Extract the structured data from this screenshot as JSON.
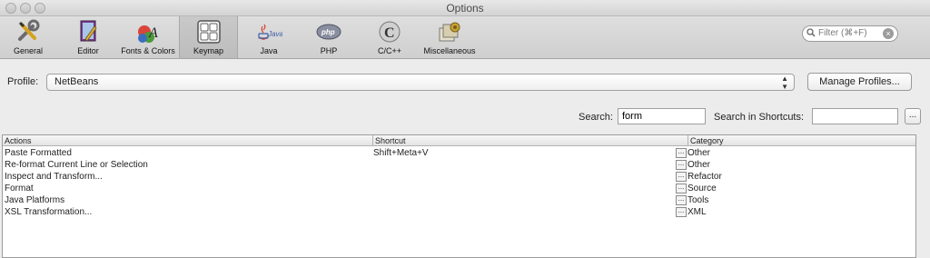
{
  "window": {
    "title": "Options"
  },
  "toolbar": {
    "tabs": [
      {
        "label": "General",
        "icon": "wrench-screwdriver-icon"
      },
      {
        "label": "Editor",
        "icon": "editor-pencil-icon"
      },
      {
        "label": "Fonts & Colors",
        "icon": "fonts-colors-icon"
      },
      {
        "label": "Keymap",
        "icon": "keyboard-icon",
        "selected": true
      },
      {
        "label": "Java",
        "icon": "java-icon"
      },
      {
        "label": "PHP",
        "icon": "php-icon"
      },
      {
        "label": "C/C++",
        "icon": "c-cpp-icon"
      },
      {
        "label": "Miscellaneous",
        "icon": "miscellaneous-icon"
      }
    ],
    "filter_placeholder": "Filter (⌘+F)"
  },
  "profile": {
    "label": "Profile:",
    "value": "NetBeans",
    "manage_button": "Manage Profiles..."
  },
  "search": {
    "label": "Search:",
    "value": "form",
    "shortcut_label": "Search in Shortcuts:",
    "shortcut_value": "",
    "more_button": "..."
  },
  "table": {
    "columns": [
      "Actions",
      "Shortcut",
      "Category"
    ],
    "rows": [
      {
        "action": "Paste Formatted",
        "shortcut": "Shift+Meta+V",
        "category": "Other"
      },
      {
        "action": "Re-format Current Line or Selection",
        "shortcut": "",
        "category": "Other"
      },
      {
        "action": "Inspect and Transform...",
        "shortcut": "",
        "category": "Refactor"
      },
      {
        "action": "Format",
        "shortcut": "",
        "category": "Source"
      },
      {
        "action": "Java Platforms",
        "shortcut": "",
        "category": "Tools"
      },
      {
        "action": "XSL Transformation...",
        "shortcut": "",
        "category": "XML"
      }
    ],
    "cell_button": "..."
  }
}
